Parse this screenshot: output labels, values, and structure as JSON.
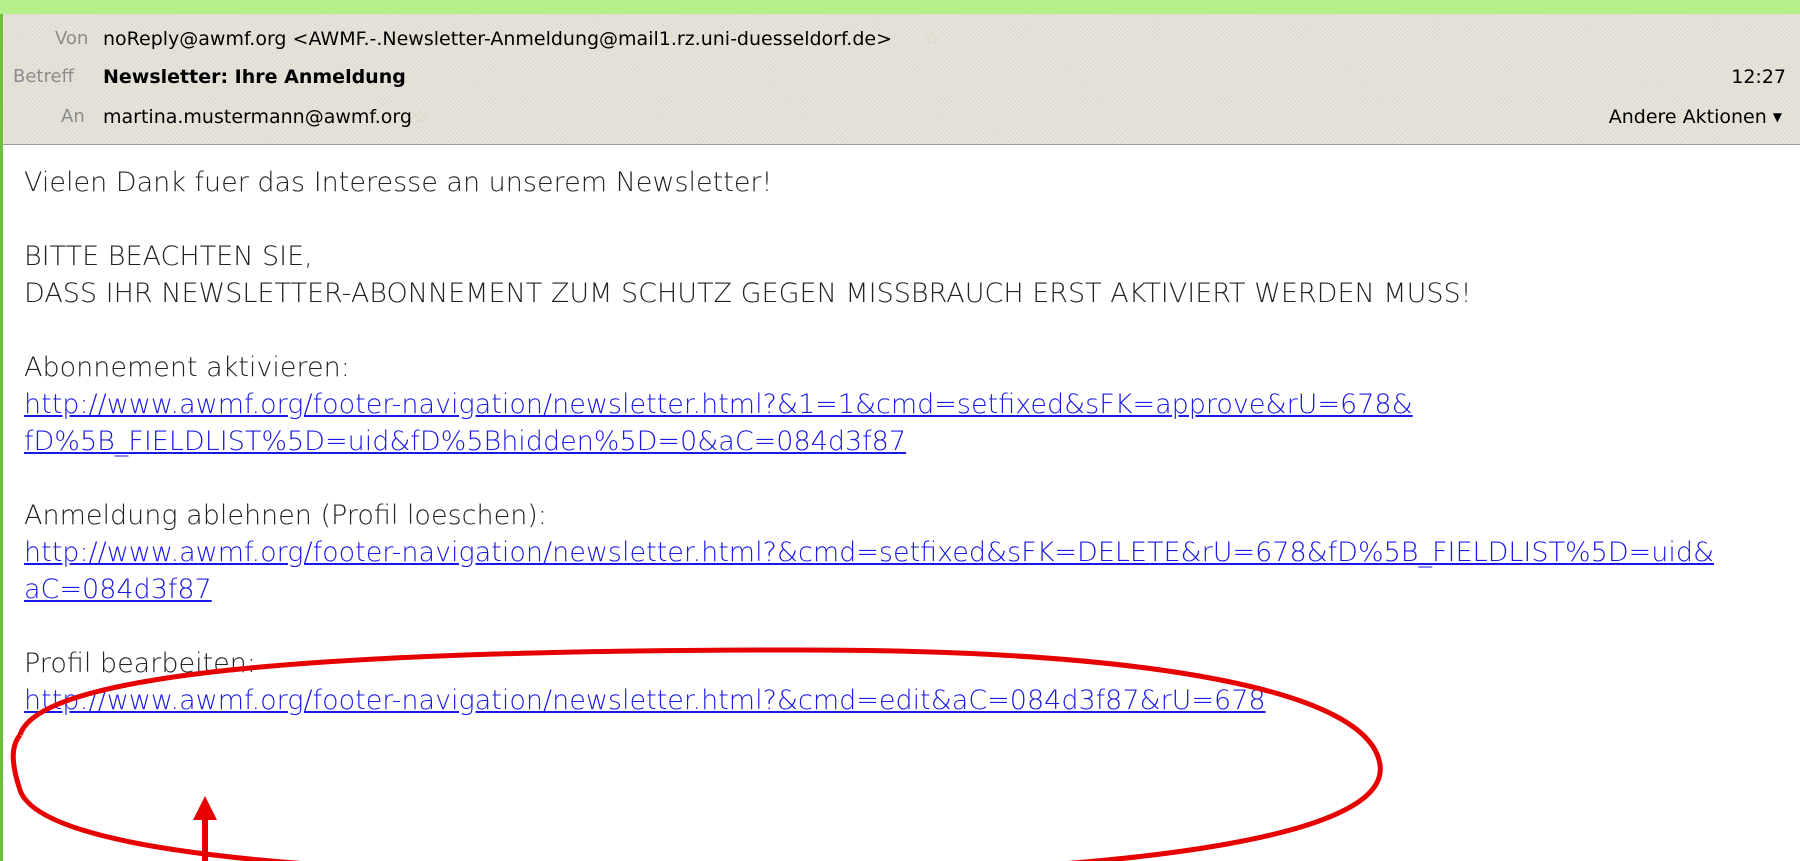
{
  "header": {
    "from_label": "Von",
    "from_value": "noReply@awmf.org <AWMF.-.Newsletter-Anmeldung@mail1.rz.uni-duesseldorf.de>",
    "subject_label": "Betreff",
    "subject_value": "Newsletter: Ihre Anmeldung",
    "time": "12:27",
    "to_label": "An",
    "to_value": "martina.mustermann@awmf.org",
    "more_actions": "Andere Aktionen",
    "star_icon": "star-icon",
    "caret_icon": "chevron-down-icon"
  },
  "body": {
    "thanks": "Vielen Dank fuer das Interesse an unserem Newsletter!",
    "notice_line1": "BITTE BEACHTEN SIE,",
    "notice_line2": "DASS IHR NEWSLETTER-ABONNEMENT ZUM SCHUTZ GEGEN MISSBRAUCH ERST AKTIVIERT WERDEN MUSS!",
    "activate_label": "Abonnement aktivieren:",
    "activate_link_line1": "http://www.awmf.org/footer-navigation/newsletter.html?&1=1&cmd=setfixed&sFK=approve&rU=678&",
    "activate_link_line2": "fD%5B_FIELDLIST%5D=uid&fD%5Bhidden%5D=0&aC=084d3f87",
    "decline_label": "Anmeldung ablehnen (Profil loeschen):",
    "decline_link_line1": "http://www.awmf.org/footer-navigation/newsletter.html?&cmd=setfixed&sFK=DELETE&rU=678&fD%5B_FIELDLIST%5D=uid&",
    "decline_link_line2": "aC=084d3f87",
    "edit_label": "Profil bearbeiten:",
    "edit_link": "http://www.awmf.org/footer-navigation/newsletter.html?&cmd=edit&aC=084d3f87&rU=678"
  },
  "annotation": {
    "color": "#e60000"
  }
}
